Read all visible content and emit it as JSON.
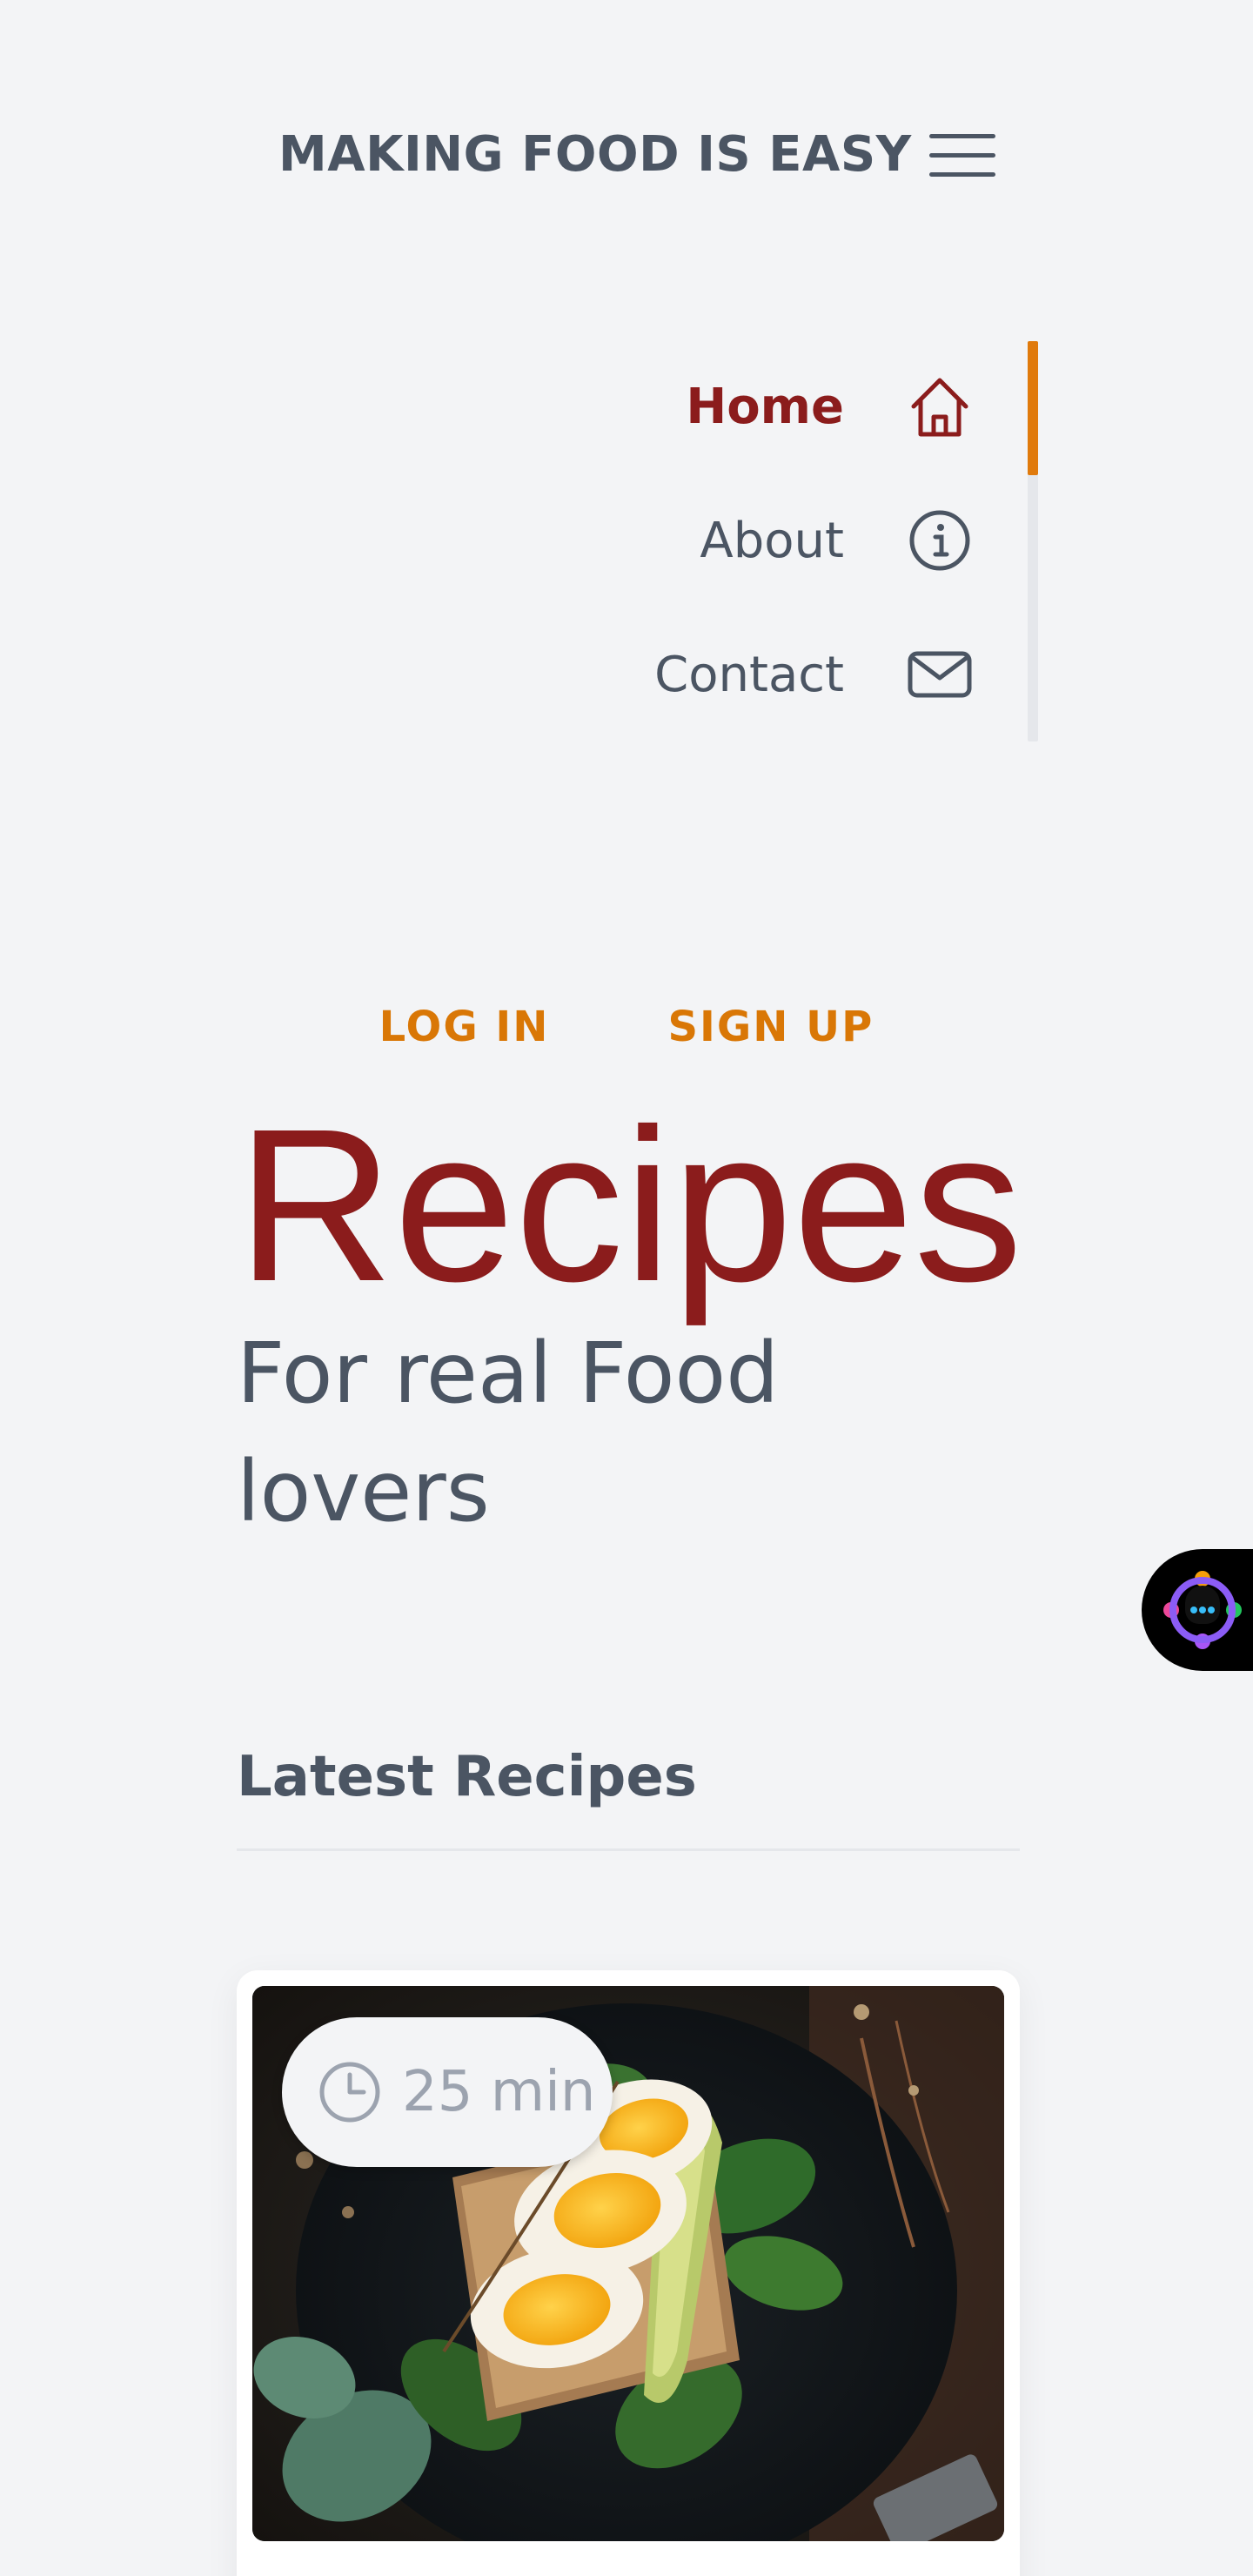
{
  "header": {
    "title": "MAKING FOOD IS EASY"
  },
  "nav": {
    "items": [
      {
        "label": "Home",
        "icon": "home-icon",
        "active": true
      },
      {
        "label": "About",
        "icon": "info-icon",
        "active": false
      },
      {
        "label": "Contact",
        "icon": "mail-icon",
        "active": false
      }
    ]
  },
  "auth": {
    "login_label": "LOG IN",
    "signup_label": "SIGN UP"
  },
  "hero": {
    "title": "Recipes",
    "subtitle": "For real Food lovers"
  },
  "latest": {
    "title": "Latest Recipes",
    "cards": [
      {
        "time": "25 min"
      }
    ]
  },
  "colors": {
    "accent": "#d97706",
    "brand": "#8b1c1c",
    "text": "#4b5563",
    "background": "#f3f4f6"
  }
}
